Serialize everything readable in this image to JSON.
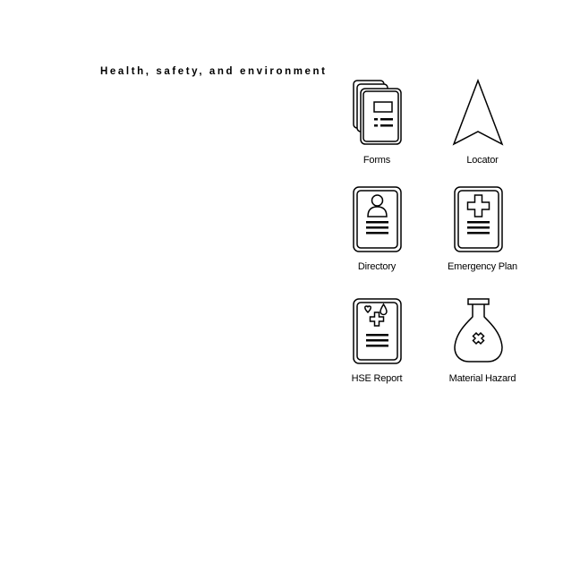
{
  "title": "Health, safety, and environment",
  "tiles": [
    {
      "label": "Forms",
      "icon": "forms-icon"
    },
    {
      "label": "Locator",
      "icon": "locator-arrow-icon"
    },
    {
      "label": "Directory",
      "icon": "directory-icon"
    },
    {
      "label": "Emergency Plan",
      "icon": "emergency-plan-icon"
    },
    {
      "label": "HSE Report",
      "icon": "hse-report-icon"
    },
    {
      "label": "Material Hazard",
      "icon": "material-hazard-icon"
    }
  ]
}
